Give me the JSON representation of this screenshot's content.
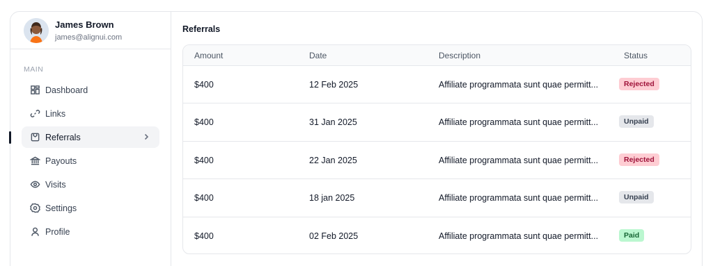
{
  "user": {
    "name": "James Brown",
    "email": "james@alignui.com"
  },
  "sidebar": {
    "section_label": "MAIN",
    "items": [
      {
        "label": "Dashboard",
        "icon": "dashboard-icon"
      },
      {
        "label": "Links",
        "icon": "link-icon"
      },
      {
        "label": "Referrals",
        "icon": "referrals-icon",
        "active": true
      },
      {
        "label": "Payouts",
        "icon": "bank-icon"
      },
      {
        "label": "Visits",
        "icon": "eye-icon"
      },
      {
        "label": "Settings",
        "icon": "settings-icon"
      },
      {
        "label": "Profile",
        "icon": "user-icon"
      }
    ]
  },
  "main": {
    "title": "Referrals",
    "table": {
      "columns": [
        "Amount",
        "Date",
        "Description",
        "Status"
      ],
      "rows": [
        {
          "amount": "$400",
          "date": "12 Feb 2025",
          "description": "Affiliate programmata sunt quae permitt...",
          "status": "Rejected"
        },
        {
          "amount": "$400",
          "date": "31 Jan 2025",
          "description": "Affiliate programmata sunt quae permitt...",
          "status": "Unpaid"
        },
        {
          "amount": "$400",
          "date": "22 Jan 2025",
          "description": "Affiliate programmata sunt quae permitt...",
          "status": "Rejected"
        },
        {
          "amount": "$400",
          "date": "18 jan 2025",
          "description": "Affiliate programmata sunt quae permitt...",
          "status": "Unpaid"
        },
        {
          "amount": "$400",
          "date": "02 Feb 2025",
          "description": "Affiliate programmata sunt quae permitt...",
          "status": "Paid"
        }
      ]
    }
  },
  "colors": {
    "rejected_bg": "#fecdd3",
    "unpaid_bg": "#e5e7eb",
    "paid_bg": "#bbf7d0"
  }
}
